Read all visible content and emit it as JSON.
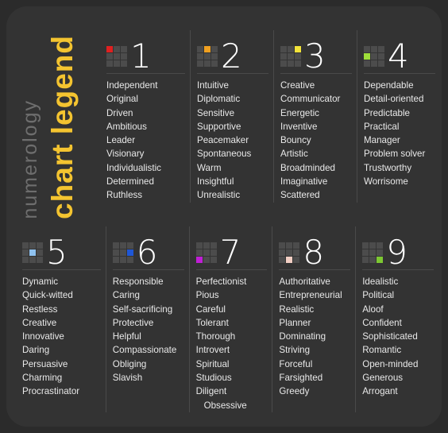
{
  "title": {
    "word_top": "numerology",
    "word_bottom": "chart legend",
    "color_top": "#6e6e6e",
    "color_bottom": "#f4c430"
  },
  "theme": {
    "background": "#2b2b2b",
    "card": "#333333",
    "text": "#e9e9e9",
    "numeral": "#ffffff",
    "divider": "#4a4a4a",
    "icon_cell": "#4c4c4c"
  },
  "numbers": [
    {
      "numeral": "1",
      "icon_name": "grid-icon-1",
      "accent_color": "#e02020",
      "accent_cell": 0,
      "traits": [
        "Independent",
        "Original",
        "Driven",
        "Ambitious",
        "Leader",
        "Visionary",
        "Individualistic",
        "Determined",
        "Ruthless"
      ]
    },
    {
      "numeral": "2",
      "icon_name": "grid-icon-2",
      "accent_color": "#f0a020",
      "accent_cell": 1,
      "traits": [
        "Intuitive",
        "Diplomatic",
        "Sensitive",
        "Supportive",
        "Peacemaker",
        "Spontaneous",
        "Warm",
        "Insightful",
        "Unrealistic"
      ]
    },
    {
      "numeral": "3",
      "icon_name": "grid-icon-3",
      "accent_color": "#f2e33a",
      "accent_cell": 2,
      "traits": [
        "Creative",
        "Communicator",
        "Energetic",
        "Inventive",
        "Bouncy",
        "Artistic",
        "Broadminded",
        "Imaginative",
        "Scattered"
      ]
    },
    {
      "numeral": "4",
      "icon_name": "grid-icon-4",
      "accent_color": "#9ede3a",
      "accent_cell": 3,
      "traits": [
        "Dependable",
        "Detail-oriented",
        "Predictable",
        "Practical",
        "Manager",
        "Problem solver",
        "Trustworthy",
        "Worrisome"
      ]
    },
    {
      "numeral": "5",
      "icon_name": "grid-icon-5",
      "accent_color": "#8fc2f0",
      "accent_cell": 4,
      "traits": [
        "Dynamic",
        "Quick-witted",
        "Restless",
        "Creative",
        "Innovative",
        "Daring",
        "Persuasive",
        "Charming",
        "Procrastinator"
      ]
    },
    {
      "numeral": "6",
      "icon_name": "grid-icon-6",
      "accent_color": "#1f57d6",
      "accent_cell": 5,
      "traits": [
        "Responsible",
        "Caring",
        "Self-sacrificing",
        "Protective",
        "Helpful",
        "Compassionate",
        "Obliging",
        "Slavish"
      ]
    },
    {
      "numeral": "7",
      "icon_name": "grid-icon-7",
      "accent_color": "#c01fd6",
      "accent_cell": 6,
      "traits": [
        "Perfectionist",
        "Pious",
        "Careful",
        "Tolerant",
        "Thorough",
        "Introvert",
        "Spiritual",
        "Studious",
        "Diligent",
        "Obsessive"
      ]
    },
    {
      "numeral": "8",
      "icon_name": "grid-icon-8",
      "accent_color": "#f2cfc4",
      "accent_cell": 7,
      "traits": [
        "Authoritative",
        "Entrepreneurial",
        "Realistic",
        "Planner",
        "Dominating",
        "Striving",
        "Forceful",
        "Farsighted",
        "Greedy"
      ]
    },
    {
      "numeral": "9",
      "icon_name": "grid-icon-9",
      "accent_color": "#7dc832",
      "accent_cell": 8,
      "traits": [
        "Idealistic",
        "Political",
        "Aloof",
        "Confident",
        "Sophisticated",
        "Romantic",
        "Open-minded",
        "Generous",
        "Arrogant"
      ]
    }
  ]
}
